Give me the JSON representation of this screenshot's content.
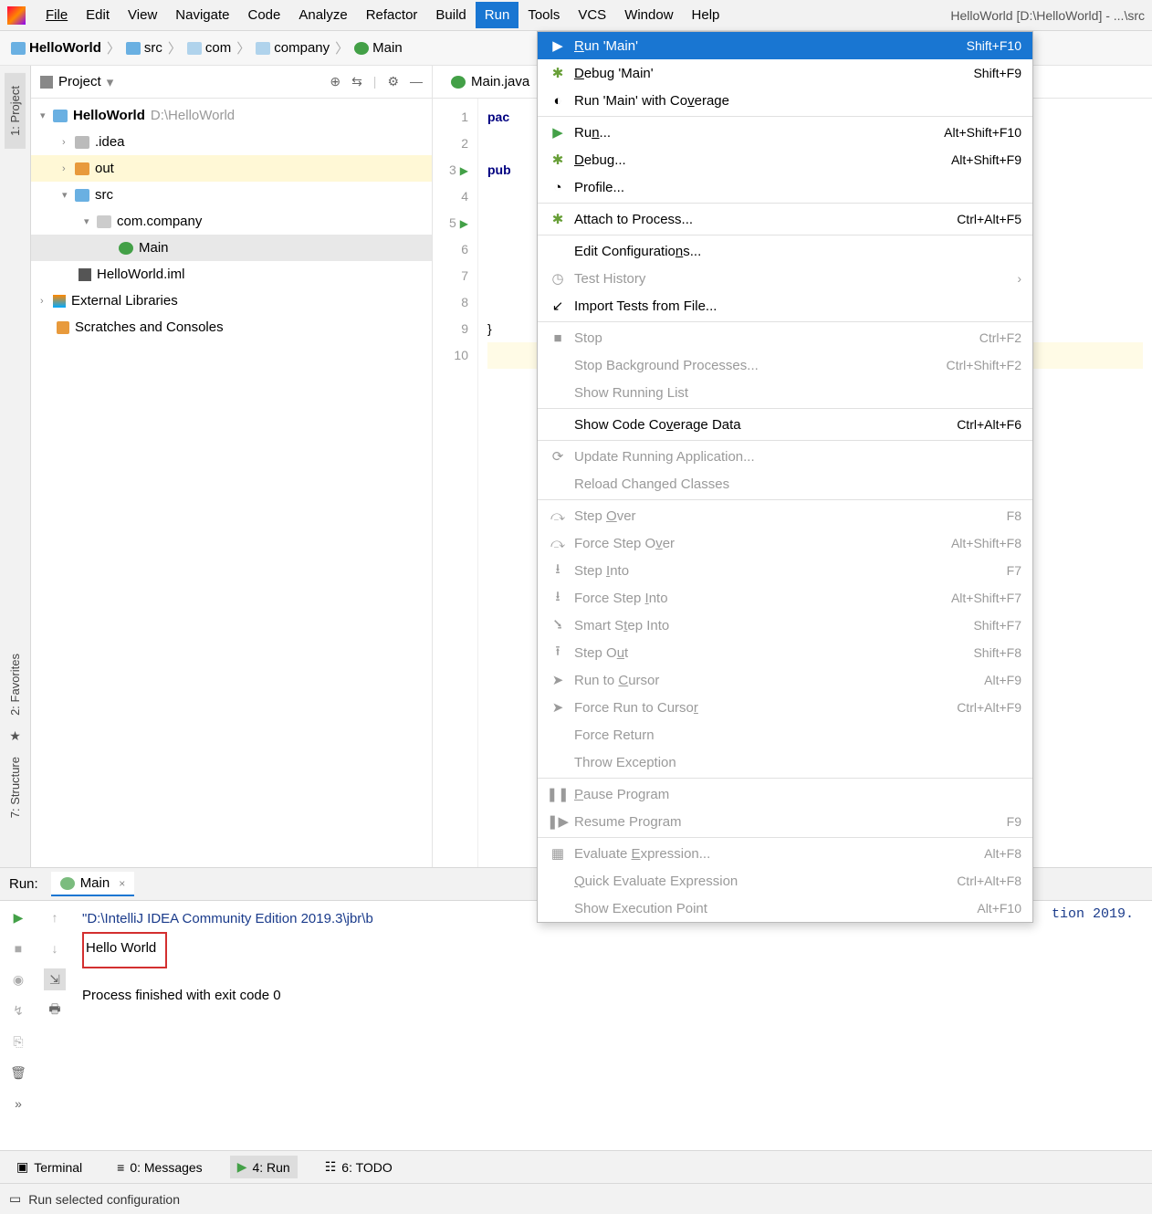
{
  "window_title": "HelloWorld [D:\\HelloWorld] - ...\\src",
  "menubar": [
    "File",
    "Edit",
    "View",
    "Navigate",
    "Code",
    "Analyze",
    "Refactor",
    "Build",
    "Run",
    "Tools",
    "VCS",
    "Window",
    "Help"
  ],
  "menubar_open_index": 8,
  "breadcrumb": {
    "items": [
      "HelloWorld",
      "src",
      "com",
      "company",
      "Main"
    ]
  },
  "project": {
    "title": "Project",
    "tree": {
      "root": {
        "label": "HelloWorld",
        "path": "D:\\HelloWorld"
      },
      "idea": ".idea",
      "out": "out",
      "src": "src",
      "pkg": "com.company",
      "main": "Main",
      "iml": "HelloWorld.iml",
      "ext": "External Libraries",
      "scratch": "Scratches and Consoles"
    }
  },
  "editor": {
    "tab": "Main.java",
    "lines": [
      "1",
      "2",
      "3",
      "4",
      "5",
      "6",
      "7",
      "8",
      "9",
      "10"
    ],
    "code": [
      "pac",
      "",
      "pub",
      "",
      "",
      "",
      "",
      "",
      "}",
      ""
    ]
  },
  "run_menu": [
    {
      "icon": "play",
      "color": "green",
      "label": "Run 'Main'",
      "shortcut": "Shift+F10",
      "sel": true,
      "u": 0
    },
    {
      "icon": "bug",
      "color": "bug",
      "label": "Debug 'Main'",
      "shortcut": "Shift+F9",
      "u": 0
    },
    {
      "icon": "cov",
      "label": "Run 'Main' with Coverage",
      "u": 18
    },
    {
      "sep": true
    },
    {
      "icon": "play",
      "color": "green",
      "label": "Run...",
      "shortcut": "Alt+Shift+F10",
      "u": 2
    },
    {
      "icon": "bug",
      "color": "bug",
      "label": "Debug...",
      "shortcut": "Alt+Shift+F9",
      "u": 0
    },
    {
      "icon": "prof",
      "label": "Profile..."
    },
    {
      "sep": true
    },
    {
      "icon": "attach",
      "color": "bug",
      "label": "Attach to Process...",
      "shortcut": "Ctrl+Alt+F5"
    },
    {
      "sep": true
    },
    {
      "label": "Edit Configurations...",
      "u": 17
    },
    {
      "icon": "clock",
      "label": "Test History",
      "dis": true,
      "sub": true
    },
    {
      "icon": "import",
      "label": "Import Tests from File..."
    },
    {
      "sep": true
    },
    {
      "icon": "stop",
      "label": "Stop",
      "shortcut": "Ctrl+F2",
      "dis": true
    },
    {
      "label": "Stop Background Processes...",
      "shortcut": "Ctrl+Shift+F2",
      "dis": true
    },
    {
      "label": "Show Running List",
      "dis": true
    },
    {
      "sep": true
    },
    {
      "label": "Show Code Coverage Data",
      "shortcut": "Ctrl+Alt+F6",
      "u": 12
    },
    {
      "sep": true
    },
    {
      "icon": "upd",
      "label": "Update Running Application...",
      "dis": true
    },
    {
      "label": "Reload Changed Classes",
      "dis": true
    },
    {
      "sep": true
    },
    {
      "icon": "stepover",
      "label": "Step Over",
      "shortcut": "F8",
      "dis": true,
      "u": 5
    },
    {
      "icon": "stepover",
      "label": "Force Step Over",
      "shortcut": "Alt+Shift+F8",
      "dis": true,
      "u": 12
    },
    {
      "icon": "stepinto",
      "label": "Step Into",
      "shortcut": "F7",
      "dis": true,
      "u": 5
    },
    {
      "icon": "stepinto",
      "label": "Force Step Into",
      "shortcut": "Alt+Shift+F7",
      "dis": true,
      "u": 11
    },
    {
      "icon": "smart",
      "label": "Smart Step Into",
      "shortcut": "Shift+F7",
      "dis": true,
      "u": 7
    },
    {
      "icon": "stepout",
      "label": "Step Out",
      "shortcut": "Shift+F8",
      "dis": true,
      "u": 6
    },
    {
      "icon": "cursor",
      "label": "Run to Cursor",
      "shortcut": "Alt+F9",
      "dis": true,
      "u": 7
    },
    {
      "icon": "cursor",
      "label": "Force Run to Cursor",
      "shortcut": "Ctrl+Alt+F9",
      "dis": true,
      "u": 18
    },
    {
      "label": "Force Return",
      "dis": true
    },
    {
      "label": "Throw Exception",
      "dis": true
    },
    {
      "sep": true
    },
    {
      "icon": "pause",
      "label": "Pause Program",
      "dis": true,
      "u": 0
    },
    {
      "icon": "resume",
      "label": "Resume Program",
      "shortcut": "F9",
      "dis": true
    },
    {
      "sep": true
    },
    {
      "icon": "eval",
      "label": "Evaluate Expression...",
      "shortcut": "Alt+F8",
      "dis": true,
      "u": 9
    },
    {
      "label": "Quick Evaluate Expression",
      "shortcut": "Ctrl+Alt+F8",
      "dis": true,
      "u": 0
    },
    {
      "label": "Show Execution Point",
      "shortcut": "Alt+F10",
      "dis": true
    }
  ],
  "run_panel": {
    "label": "Run:",
    "tab": "Main",
    "lines": [
      "\"D:\\IntelliJ IDEA Community Edition 2019.3\\jbr\\b",
      "Hello World",
      "",
      "Process finished with exit code 0"
    ],
    "right_frag": "tion 2019."
  },
  "bottom_tabs": {
    "terminal": "Terminal",
    "messages": "0: Messages",
    "run": "4: Run",
    "todo": "6: TODO"
  },
  "statusbar": "Run selected configuration",
  "left_tabs": {
    "project": "1: Project",
    "structure": "7: Structure",
    "favorites": "2: Favorites"
  }
}
